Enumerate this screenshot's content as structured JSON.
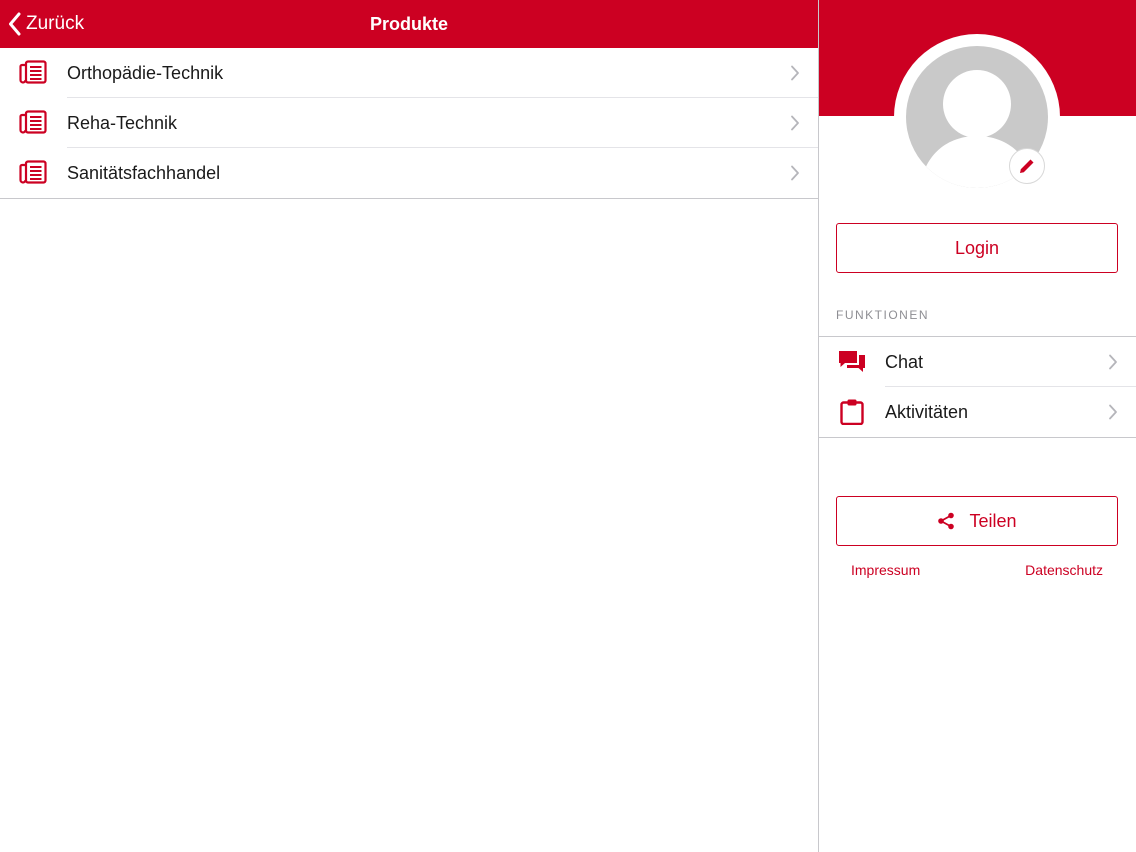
{
  "colors": {
    "accent": "#cc0022",
    "separator": "#c8c8cc",
    "avatar": "#c9c9c9",
    "text": "#1a1a1a",
    "muted": "#8e8e93"
  },
  "navbar": {
    "back_label": "Zurück",
    "title": "Produkte",
    "back_icon": "chevron-left-icon"
  },
  "products": {
    "items": [
      {
        "label": "Orthopädie-Technik",
        "icon": "catalog-icon"
      },
      {
        "label": "Reha-Technik",
        "icon": "catalog-icon"
      },
      {
        "label": "Sanitätsfachhandel",
        "icon": "catalog-icon"
      }
    ]
  },
  "profile": {
    "avatar_icon": "user-placeholder-icon",
    "edit_icon": "pencil-icon",
    "login_label": "Login"
  },
  "functions": {
    "header": "FUNKTIONEN",
    "items": [
      {
        "label": "Chat",
        "icon": "chat-bubbles-icon"
      },
      {
        "label": "Aktivitäten",
        "icon": "clipboard-icon"
      }
    ]
  },
  "share": {
    "label": "Teilen",
    "icon": "share-icon"
  },
  "footer": {
    "impressum": "Impressum",
    "datenschutz": "Datenschutz"
  }
}
